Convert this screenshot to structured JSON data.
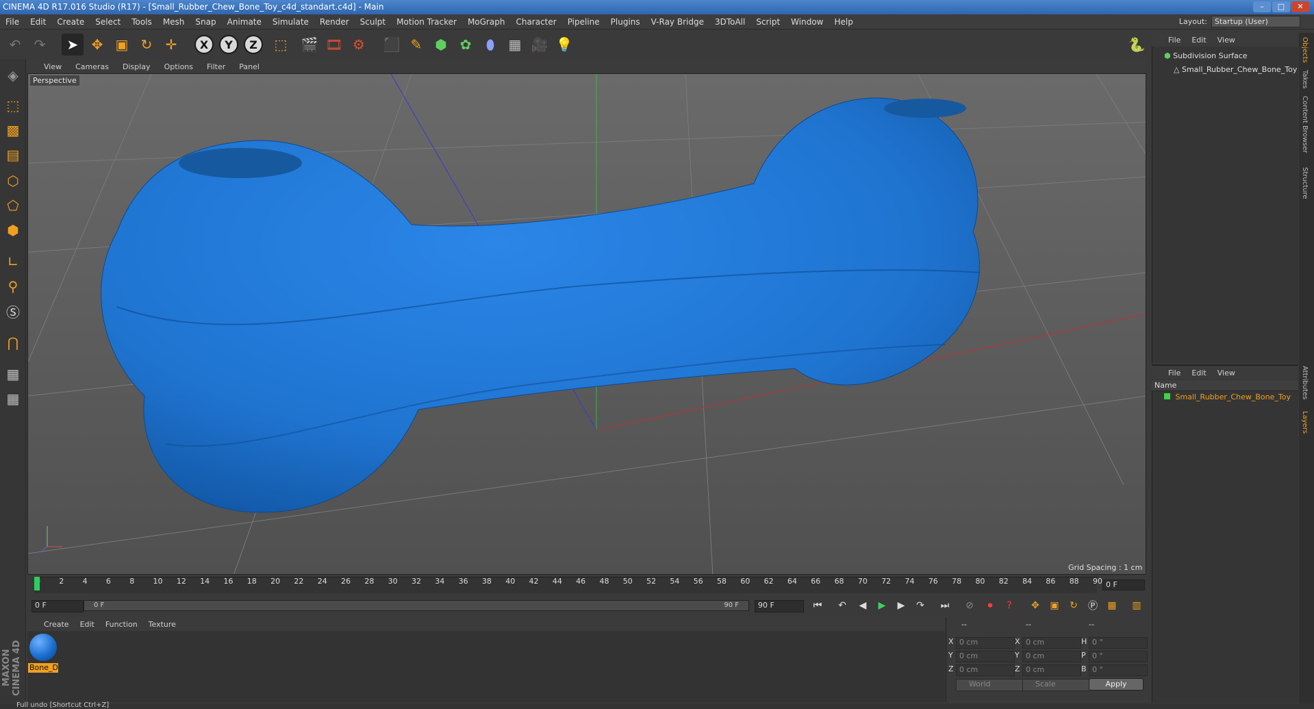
{
  "app": {
    "title": "CINEMA 4D R17.016 Studio (R17) - [Small_Rubber_Chew_Bone_Toy_c4d_standart.c4d] - Main",
    "window_buttons": [
      "–",
      "□",
      "✕"
    ],
    "layout_label": "Layout:",
    "layout_value": "Startup (User)"
  },
  "menu": [
    "File",
    "Edit",
    "Create",
    "Select",
    "Tools",
    "Mesh",
    "Snap",
    "Animate",
    "Simulate",
    "Render",
    "Sculpt",
    "Motion Tracker",
    "MoGraph",
    "Character",
    "Pipeline",
    "Plugins",
    "V-Ray Bridge",
    "3DToAll",
    "Script",
    "Window",
    "Help"
  ],
  "toolbar": {
    "axis_x": "X",
    "axis_y": "Y",
    "axis_z": "Z"
  },
  "viewport": {
    "menu": [
      "View",
      "Cameras",
      "Display",
      "Options",
      "Filter",
      "Panel"
    ],
    "label": "Perspective",
    "grid_spacing": "Grid Spacing : 1 cm",
    "object_color": "#1f74d0"
  },
  "timeline": {
    "ticks": [
      "0",
      "2",
      "4",
      "6",
      "8",
      "10",
      "12",
      "14",
      "16",
      "18",
      "20",
      "22",
      "24",
      "26",
      "28",
      "30",
      "32",
      "34",
      "36",
      "38",
      "40",
      "42",
      "44",
      "46",
      "48",
      "50",
      "52",
      "54",
      "56",
      "58",
      "60",
      "62",
      "64",
      "66",
      "68",
      "70",
      "72",
      "74",
      "76",
      "78",
      "80",
      "82",
      "84",
      "86",
      "88",
      "90"
    ],
    "current_frame": "0 F",
    "start_field": "0 F",
    "range_start": "0 F",
    "range_end": "90 F",
    "end_field": "90 F"
  },
  "materials": {
    "menu": [
      "Create",
      "Edit",
      "Function",
      "Texture"
    ],
    "items": [
      {
        "name": "Bone_D",
        "color": "#1f74d0"
      }
    ]
  },
  "coordinates": {
    "header": [
      "--",
      "--",
      "--"
    ],
    "rows": [
      {
        "a": "X",
        "av": "0 cm",
        "b": "X",
        "bv": "0 cm",
        "c": "H",
        "cv": "0 °"
      },
      {
        "a": "Y",
        "av": "0 cm",
        "b": "Y",
        "bv": "0 cm",
        "c": "P",
        "cv": "0 °"
      },
      {
        "a": "Z",
        "av": "0 cm",
        "b": "Z",
        "bv": "0 cm",
        "c": "B",
        "cv": "0 °"
      }
    ],
    "world": "World",
    "scale": "Scale",
    "apply": "Apply"
  },
  "object_manager": {
    "menu": [
      "File",
      "Edit",
      "View"
    ],
    "items": [
      "Subdivision Surface",
      "Small_Rubber_Chew_Bone_Toy"
    ]
  },
  "layer_manager": {
    "menu": [
      "File",
      "Edit",
      "View"
    ],
    "name_header": "Name",
    "items": [
      "Small_Rubber_Chew_Bone_Toy"
    ]
  },
  "right_tabs": [
    "Objects",
    "Takes",
    "Content Browser",
    "Structure",
    "Attributes",
    "Layers"
  ],
  "brand": "MAXON CINEMA 4D",
  "status": "Full undo [Shortcut Ctrl+Z]"
}
